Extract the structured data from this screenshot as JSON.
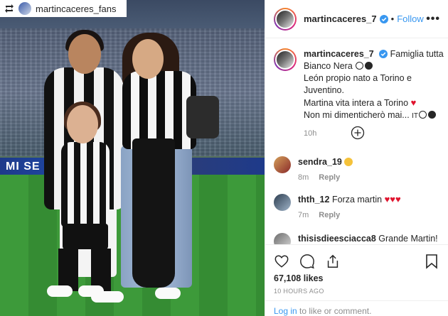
{
  "overlay": {
    "handle": "martincaceres_fans",
    "repost_icon": "repost-icon"
  },
  "photo": {
    "adboard_text": "MI SE"
  },
  "header": {
    "handle": "martincaceres_7",
    "separator": "•",
    "follow_label": "Follow",
    "more_label": "•••"
  },
  "caption": {
    "handle": "martincaceres_7",
    "line1": "Famiglia tutta",
    "line2": "Bianco Nera",
    "line3": "León propio nato a Torino e Juventino.",
    "line4": "Martina vita intera a Torino",
    "line5": "Non mi dimenticherò mai...",
    "lang": "IT",
    "time": "10h"
  },
  "comments": [
    {
      "handle": "sendra_19",
      "text": "",
      "time": "8m",
      "reply": "Reply"
    },
    {
      "handle": "thth_12",
      "text": "Forza martin",
      "time": "7m",
      "reply": "Reply"
    },
    {
      "handle": "thisisdieesciacca8",
      "text": "Grande Martin!",
      "time": "",
      "reply": ""
    }
  ],
  "actions": {
    "likes": "67,108 likes",
    "ago": "10 HOURS AGO",
    "login_link": "Log in",
    "login_rest": " to like or comment."
  },
  "colors": {
    "link": "#3897f0",
    "heart": "#e0142e",
    "muted": "#8e8e8e"
  }
}
